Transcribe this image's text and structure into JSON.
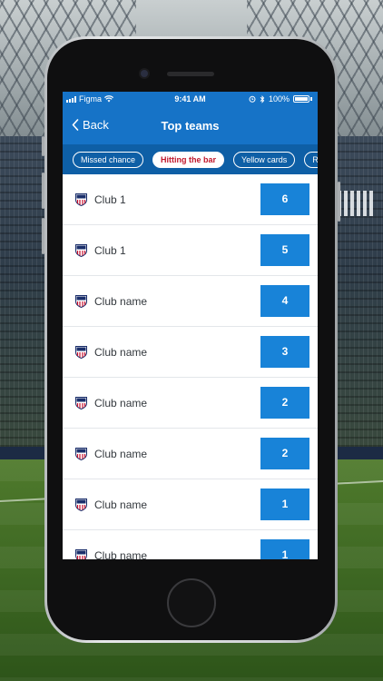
{
  "status_bar": {
    "carrier": "Figma",
    "time": "9:41 AM",
    "battery": "100%"
  },
  "nav": {
    "back_label": "Back",
    "title": "Top teams"
  },
  "filters": {
    "items": [
      "Missed chance",
      "Hitting the bar",
      "Yellow cards",
      "Red cards"
    ],
    "active": "Hitting the bar"
  },
  "teams": [
    {
      "name": "Club 1",
      "value": "6"
    },
    {
      "name": "Club 1",
      "value": "5"
    },
    {
      "name": "Club name",
      "value": "4"
    },
    {
      "name": "Club name",
      "value": "3"
    },
    {
      "name": "Club name",
      "value": "2"
    },
    {
      "name": "Club name",
      "value": "2"
    },
    {
      "name": "Club name",
      "value": "1"
    },
    {
      "name": "Club name",
      "value": "1"
    }
  ],
  "colors": {
    "header_blue": "#1673c7",
    "filter_bar": "#0e5fa6",
    "score_box": "#1883d8",
    "active_chip_text": "#c0172b"
  },
  "icons": {
    "back": "chevron-left-icon",
    "wifi": "wifi-icon",
    "alarm": "alarm-icon",
    "bluetooth": "bluetooth-icon",
    "battery": "battery-icon",
    "crest": "club-crest-icon"
  }
}
